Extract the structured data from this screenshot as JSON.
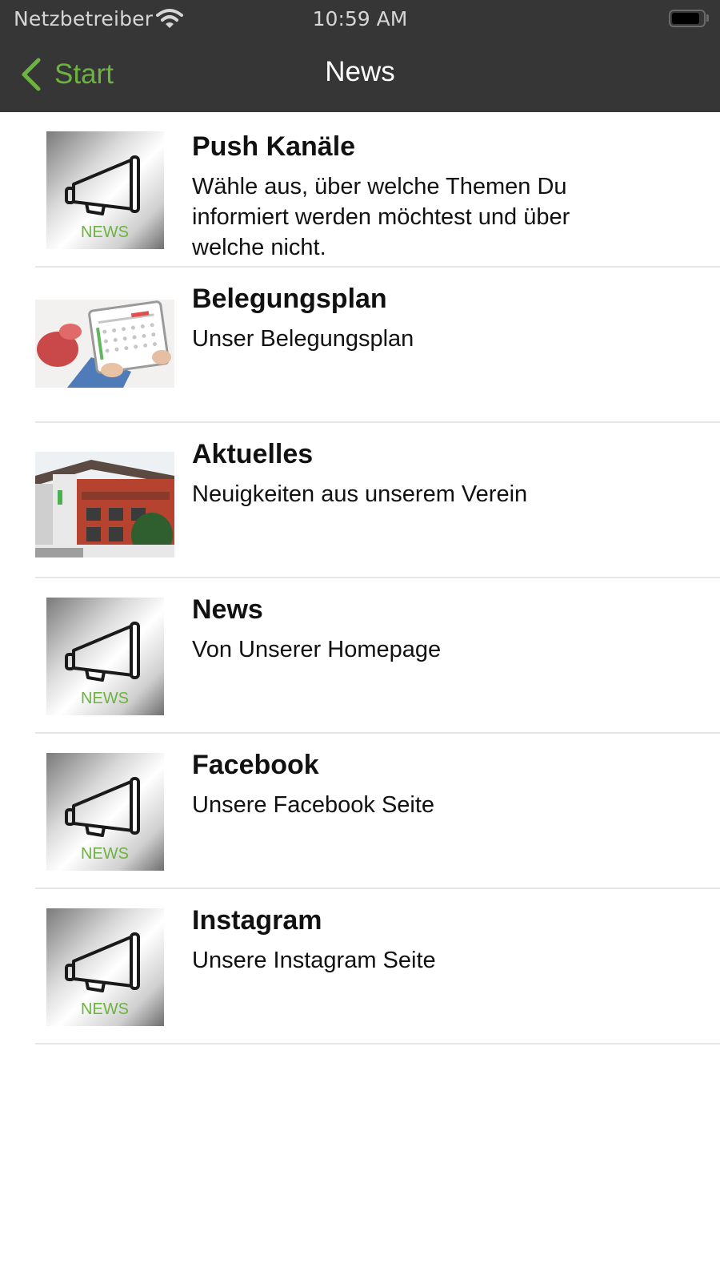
{
  "status_bar": {
    "carrier": "Netzbetreiber",
    "time": "10:59 AM",
    "wifi_icon": "wifi-icon",
    "battery_icon": "battery-icon",
    "battery_level": 0.9
  },
  "nav": {
    "back_label": "Start",
    "back_icon": "chevron-left-icon",
    "title": "News"
  },
  "colors": {
    "nav_background": "#363636",
    "accent": "#6db33f",
    "divider": "#e6e6e6"
  },
  "items": [
    {
      "title": "Push Kanäle",
      "description": "Wähle aus, über welche Themen Du informiert werden möchtest und über welche nicht.",
      "image": "megaphone-news-icon",
      "image_label": "NEWS"
    },
    {
      "title": "Belegungsplan",
      "description": "Unser Belegungsplan",
      "image": "calendar-tablet-photo"
    },
    {
      "title": "Aktuelles",
      "description": "Neuigkeiten aus unserem Verein",
      "image": "clubhouse-building-photo"
    },
    {
      "title": "News",
      "description": "Von Unserer Homepage",
      "image": "megaphone-news-icon",
      "image_label": "NEWS"
    },
    {
      "title": "Facebook",
      "description": "Unsere Facebook Seite",
      "image": "megaphone-news-icon",
      "image_label": "NEWS"
    },
    {
      "title": "Instagram",
      "description": "Unsere Instagram Seite",
      "image": "megaphone-news-icon",
      "image_label": "NEWS"
    }
  ]
}
